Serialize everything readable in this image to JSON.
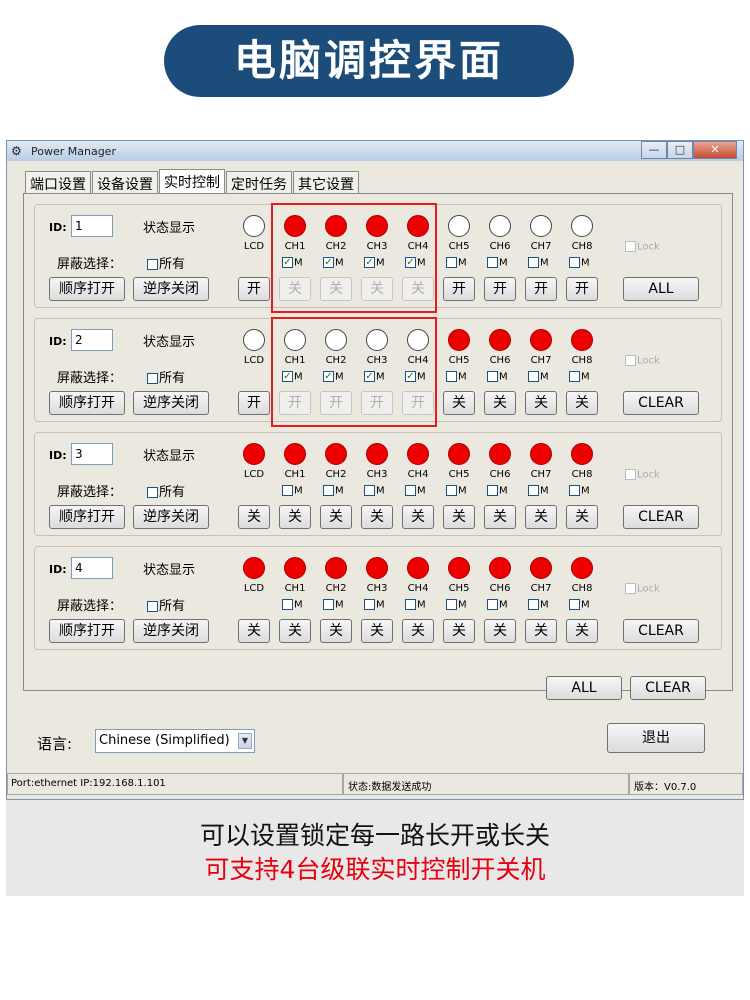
{
  "banner": {
    "title": "电脑调控界面"
  },
  "window": {
    "title": "Power Manager",
    "controls": {
      "minimize": "—",
      "maximize": "□",
      "close": "✕"
    },
    "tabs": [
      {
        "label": "端口设置",
        "active": false
      },
      {
        "label": "设备设置",
        "active": false
      },
      {
        "label": "实时控制",
        "active": true
      },
      {
        "label": "定时任务",
        "active": false
      },
      {
        "label": "其它设置",
        "active": false
      }
    ],
    "group_labels": {
      "id": "ID:",
      "status": "状态显示",
      "mask": "屏蔽选择：",
      "all_chk": "所有",
      "seq_open": "顺序打开",
      "rev_close": "逆序关闭",
      "lock": "Lock",
      "m": "M"
    },
    "channel_labels": [
      "LCD",
      "CH1",
      "CH2",
      "CH3",
      "CH4",
      "CH5",
      "CH6",
      "CH7",
      "CH8"
    ],
    "devices": [
      {
        "id": "1",
        "leds_on": [
          false,
          true,
          true,
          true,
          true,
          false,
          false,
          false,
          false
        ],
        "masked": [
          true,
          true,
          true,
          true,
          false,
          false,
          false,
          false
        ],
        "buttons": [
          "开",
          "关",
          "关",
          "关",
          "关",
          "开",
          "开",
          "开",
          "开"
        ],
        "disabled": [
          false,
          true,
          true,
          true,
          true,
          false,
          false,
          false,
          false
        ],
        "action": "ALL"
      },
      {
        "id": "2",
        "leds_on": [
          false,
          false,
          false,
          false,
          false,
          true,
          true,
          true,
          true
        ],
        "masked": [
          true,
          true,
          true,
          true,
          false,
          false,
          false,
          false
        ],
        "buttons": [
          "开",
          "开",
          "开",
          "开",
          "开",
          "关",
          "关",
          "关",
          "关"
        ],
        "disabled": [
          false,
          true,
          true,
          true,
          true,
          false,
          false,
          false,
          false
        ],
        "action": "CLEAR"
      },
      {
        "id": "3",
        "leds_on": [
          true,
          true,
          true,
          true,
          true,
          true,
          true,
          true,
          true
        ],
        "masked": [
          false,
          false,
          false,
          false,
          false,
          false,
          false,
          false
        ],
        "buttons": [
          "关",
          "关",
          "关",
          "关",
          "关",
          "关",
          "关",
          "关",
          "关"
        ],
        "disabled": [
          false,
          false,
          false,
          false,
          false,
          false,
          false,
          false,
          false
        ],
        "action": "CLEAR"
      },
      {
        "id": "4",
        "leds_on": [
          true,
          true,
          true,
          true,
          true,
          true,
          true,
          true,
          true
        ],
        "masked": [
          false,
          false,
          false,
          false,
          false,
          false,
          false,
          false
        ],
        "buttons": [
          "关",
          "关",
          "关",
          "关",
          "关",
          "关",
          "关",
          "关",
          "关"
        ],
        "disabled": [
          false,
          false,
          false,
          false,
          false,
          false,
          false,
          false,
          false
        ],
        "action": "CLEAR"
      }
    ],
    "bottom_buttons": {
      "all": "ALL",
      "clear": "CLEAR"
    },
    "language": {
      "label": "语言:",
      "value": "Chinese (Simplified)"
    },
    "exit_button": "退出",
    "statusbar": {
      "port": "Port:ethernet IP:192.168.1.101",
      "status": "状态:数据发送成功",
      "version": "版本：V0.7.0"
    }
  },
  "caption": {
    "line1": "可以设置锁定每一路长开或长关",
    "line2": "可支持4台级联实时控制开关机"
  },
  "colors": {
    "banner": "#1b4c7a",
    "led_on": "#ee0000",
    "highlight": "#e02020",
    "caption_red": "#e8000e"
  }
}
